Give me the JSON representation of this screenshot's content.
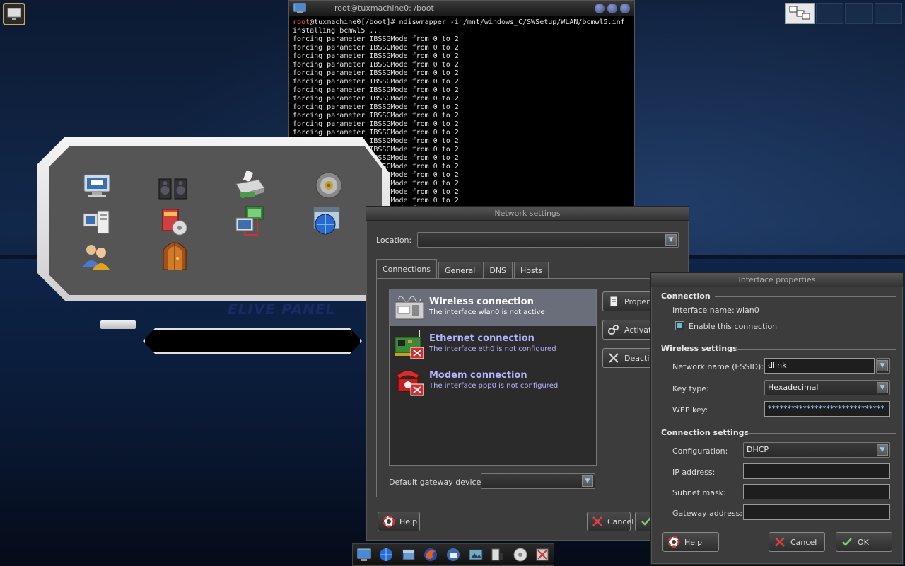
{
  "terminal": {
    "title": "root@tuxmachine0: /boot",
    "prompt_user": "root",
    "prompt_rest": "@tuxmachine0[/boot]# ndiswrapper -i /mnt/windows_C/SWSetup/WLAN/bcmwl5.inf",
    "line_install": "installing bcmwl5 ...",
    "line_param": "forcing parameter IBSSGMode from 0 to 2"
  },
  "elive": {
    "logo": "ELIVE PANEL"
  },
  "network_settings": {
    "title": "Network settings",
    "location_label": "Location:",
    "location_value": "",
    "tabs": [
      "Connections",
      "General",
      "DNS",
      "Hosts"
    ],
    "connections": [
      {
        "title": "Wireless connection",
        "status": "The interface wlan0 is not active"
      },
      {
        "title": "Ethernet connection",
        "status": "The interface eth0 is not configured"
      },
      {
        "title": "Modem connection",
        "status": "The interface ppp0 is not configured"
      }
    ],
    "side_buttons": {
      "properties": "Propert",
      "activate": "Activat",
      "deactivate": "Deactiv"
    },
    "gateway_label": "Default gateway device:",
    "gateway_value": "",
    "help": "Help",
    "cancel": "Cancel"
  },
  "interface_properties": {
    "title": "Interface properties",
    "connection_section": "Connection",
    "iface_label": "Interface name:",
    "iface_value": "wlan0",
    "enable_label": "Enable this connection",
    "enable_checked": true,
    "wireless_section": "Wireless settings",
    "essid_label": "Network name (ESSID):",
    "essid_value": "dlink",
    "keytype_label": "Key type:",
    "keytype_value": "Hexadecimal",
    "wep_label": "WEP key:",
    "wep_value": "******************************",
    "connset_section": "Connection settings",
    "config_label": "Configuration:",
    "config_value": "DHCP",
    "ip_label": "IP address:",
    "ip_value": "",
    "subnet_label": "Subnet mask:",
    "subnet_value": "",
    "gateway_label": "Gateway address:",
    "gateway_value": "",
    "help": "Help",
    "cancel": "Cancel",
    "ok": "OK"
  },
  "colors": {
    "selected_row": "#6a6e7a",
    "link_text": "#b4b4ff",
    "status_text": "#b4b4ff"
  }
}
